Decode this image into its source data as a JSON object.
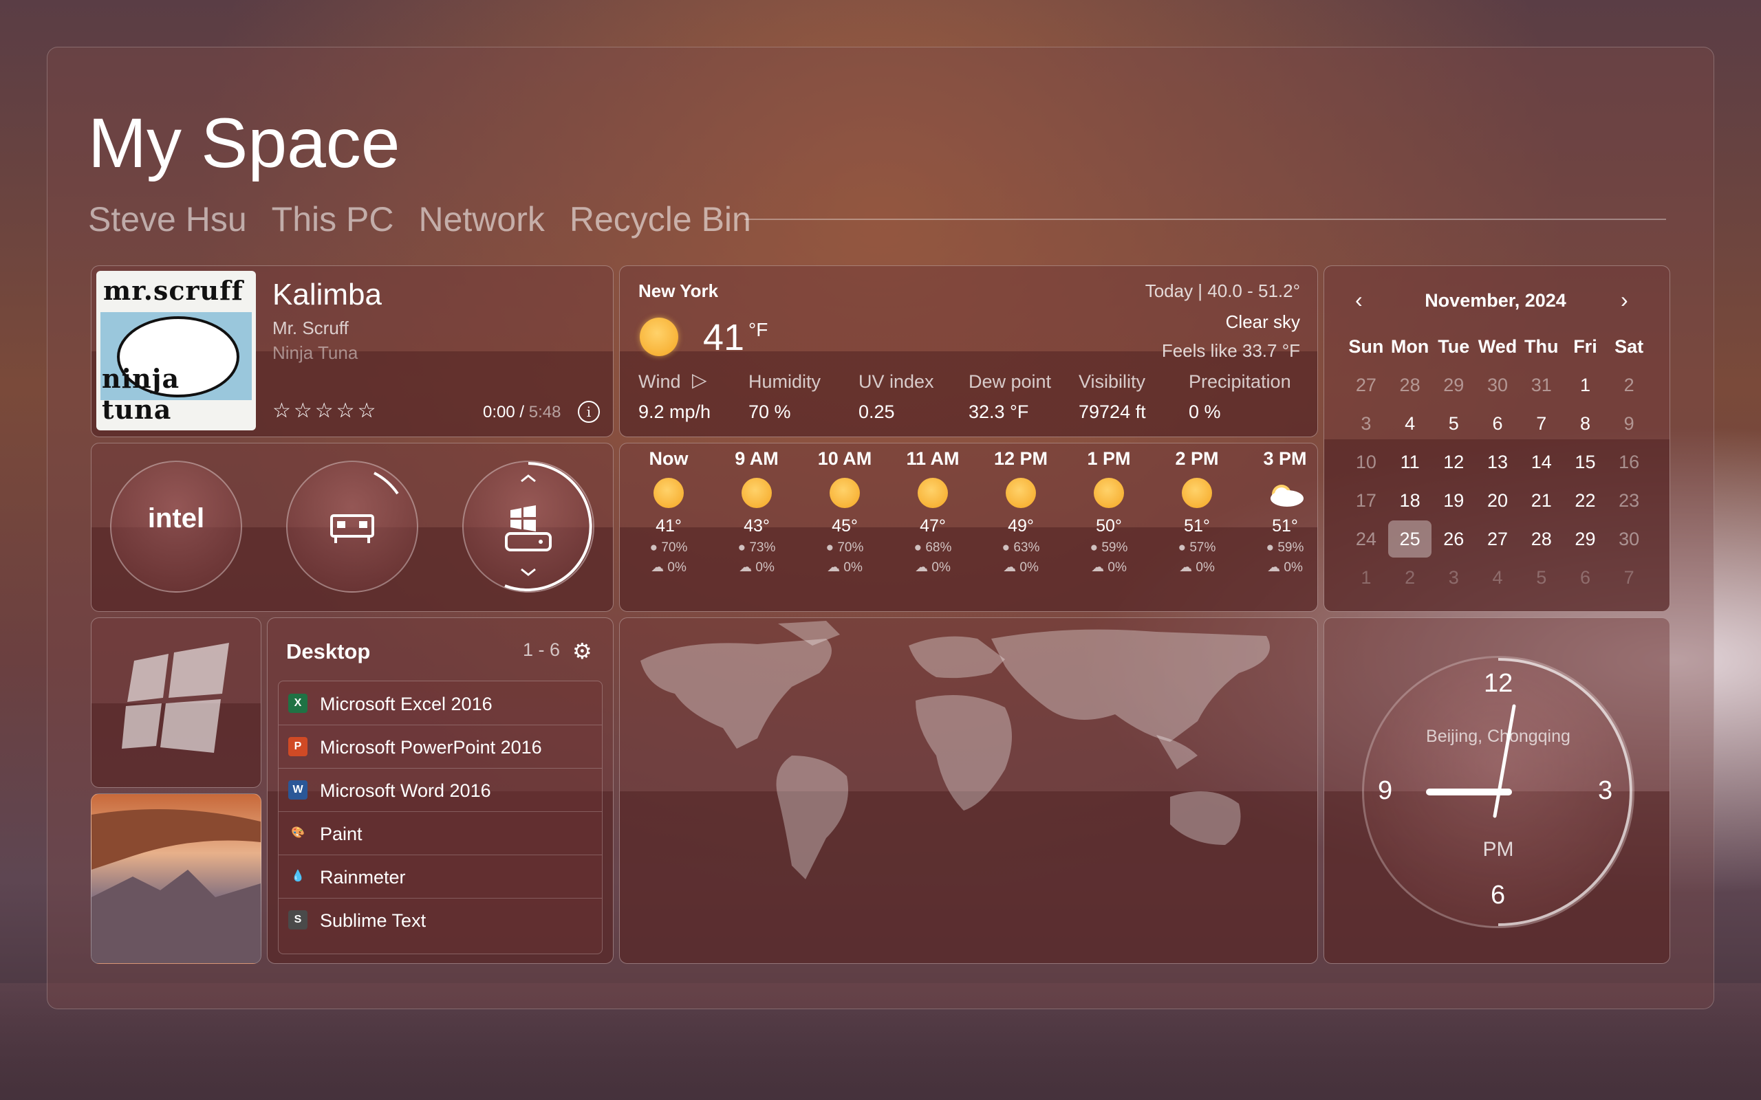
{
  "header": {
    "title": "My Space",
    "nav": [
      "Steve Hsu",
      "This PC",
      "Network",
      "Recycle Bin"
    ]
  },
  "music": {
    "album_art_text_top": "mr.scruff",
    "album_art_text_bottom": "ninja tuna",
    "song": "Kalimba",
    "artist": "Mr. Scruff",
    "album": "Ninja Tuna",
    "rating": "☆☆☆☆☆",
    "position": "0:00 / ",
    "duration": "5:48"
  },
  "gauges": {
    "cpu_label": "intel",
    "ram_icon": "memory-chip-icon",
    "disk_icon": "windows-drive-icon"
  },
  "weather": {
    "city": "New York",
    "today": "Today | 40.0 - 51.2°",
    "sky": "Clear sky",
    "feels": "Feels like 33.7 °F",
    "temp": "41",
    "unit": "°F",
    "labels": [
      "Wind",
      "Humidity",
      "UV index",
      "Dew point",
      "Visibility",
      "Precipitation"
    ],
    "values": [
      "9.2 mp/h",
      "70 %",
      "0.25",
      "32.3 °F",
      "79724 ft",
      "0 %"
    ],
    "hourly": [
      {
        "hour": "Now",
        "temp": "41°",
        "hum": "70%",
        "precip": "0%",
        "icon": "sun"
      },
      {
        "hour": "9 AM",
        "temp": "43°",
        "hum": "73%",
        "precip": "0%",
        "icon": "sun"
      },
      {
        "hour": "10 AM",
        "temp": "45°",
        "hum": "70%",
        "precip": "0%",
        "icon": "sun"
      },
      {
        "hour": "11 AM",
        "temp": "47°",
        "hum": "68%",
        "precip": "0%",
        "icon": "sun"
      },
      {
        "hour": "12 PM",
        "temp": "49°",
        "hum": "63%",
        "precip": "0%",
        "icon": "sun"
      },
      {
        "hour": "1 PM",
        "temp": "50°",
        "hum": "59%",
        "precip": "0%",
        "icon": "sun"
      },
      {
        "hour": "2 PM",
        "temp": "51°",
        "hum": "57%",
        "precip": "0%",
        "icon": "sun"
      },
      {
        "hour": "3 PM",
        "temp": "51°",
        "hum": "59%",
        "precip": "0%",
        "icon": "cloud"
      }
    ]
  },
  "calendar": {
    "title": "November, 2024",
    "days": [
      "Sun",
      "Mon",
      "Tue",
      "Wed",
      "Thu",
      "Fri",
      "Sat"
    ],
    "weeks": [
      [
        "27",
        "28",
        "29",
        "30",
        "31",
        "1",
        "2"
      ],
      [
        "3",
        "4",
        "5",
        "6",
        "7",
        "8",
        "9"
      ],
      [
        "10",
        "11",
        "12",
        "13",
        "14",
        "15",
        "16"
      ],
      [
        "17",
        "18",
        "19",
        "20",
        "21",
        "22",
        "23"
      ],
      [
        "24",
        "25",
        "26",
        "27",
        "28",
        "29",
        "30"
      ],
      [
        "1",
        "2",
        "3",
        "4",
        "5",
        "6",
        "7"
      ]
    ],
    "today": "25"
  },
  "desktop": {
    "title": "Desktop",
    "count": "1 - 6",
    "items": [
      {
        "name": "Microsoft Excel 2016",
        "icon": "X",
        "color": "#1f7244"
      },
      {
        "name": "Microsoft PowerPoint 2016",
        "icon": "P",
        "color": "#d04a25"
      },
      {
        "name": "Microsoft Word 2016",
        "icon": "W",
        "color": "#2b5797"
      },
      {
        "name": "Paint",
        "icon": "🎨",
        "color": "transparent"
      },
      {
        "name": "Rainmeter",
        "icon": "💧",
        "color": "transparent"
      },
      {
        "name": "Sublime Text",
        "icon": "S",
        "color": "#4a4a4a"
      }
    ]
  },
  "clock": {
    "city": "Beijing, Chongqing",
    "ampm": "PM",
    "n12": "12",
    "n3": "3",
    "n6": "6",
    "n9": "9"
  }
}
